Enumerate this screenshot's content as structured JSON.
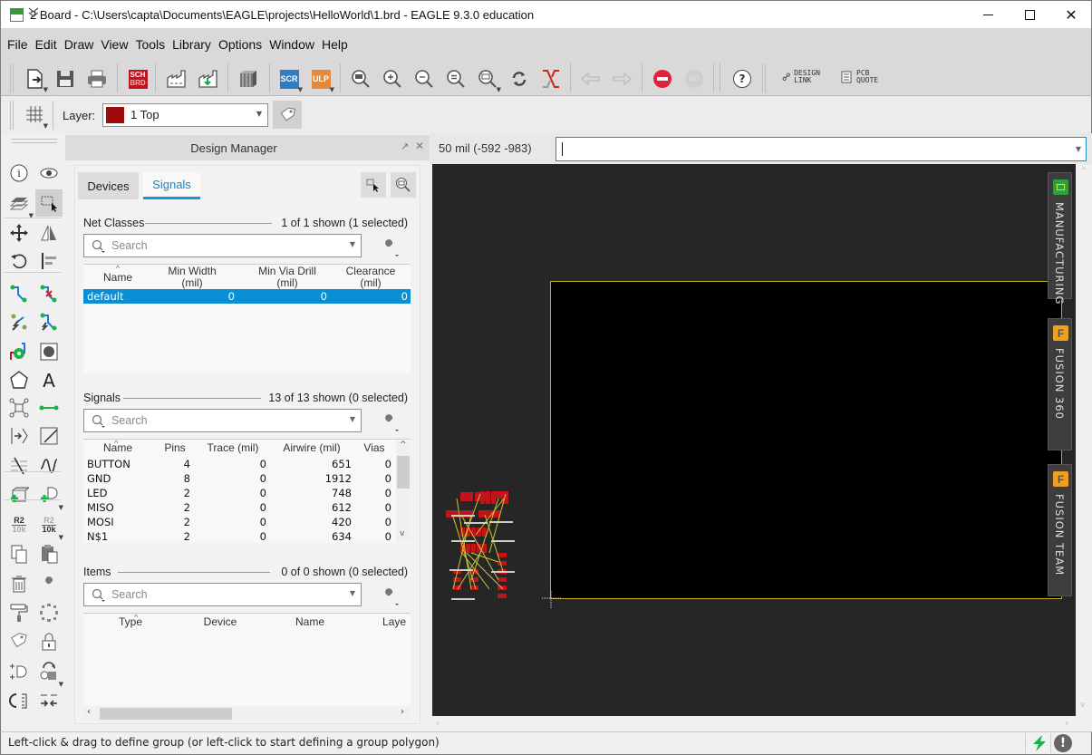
{
  "window": {
    "title": "2 Board - C:\\Users\\capta\\Documents\\EAGLE\\projects\\HelloWorld\\1.brd - EAGLE 9.3.0 education",
    "app_icon": "brd-file-icon",
    "controls": {
      "minimize": "—",
      "maximize": "☐",
      "close": "✕"
    }
  },
  "menu": [
    "File",
    "Edit",
    "Draw",
    "View",
    "Tools",
    "Library",
    "Options",
    "Window",
    "Help"
  ],
  "toolbar": {
    "items": [
      {
        "name": "open",
        "icon": "open-file-icon"
      },
      {
        "name": "save",
        "icon": "save-icon"
      },
      {
        "name": "print",
        "icon": "print-icon"
      },
      {
        "name": "switch-sch-brd",
        "icon": "sch-brd-icon",
        "label_top": "SCH",
        "label_bottom": "BRD"
      },
      {
        "name": "cam-processor",
        "icon": "factory-icon"
      },
      {
        "name": "manufacturing-export",
        "icon": "factory-download-icon"
      },
      {
        "name": "library-manager",
        "icon": "library-books-icon"
      },
      {
        "name": "script",
        "icon": "scr-icon",
        "label": "SCR",
        "color": "#2f7dc4"
      },
      {
        "name": "ulp",
        "icon": "ulp-icon",
        "label": "ULP",
        "color": "#e8893a"
      },
      {
        "name": "zoom-fit",
        "icon": "zoom-fit-icon"
      },
      {
        "name": "zoom-in",
        "icon": "zoom-in-icon"
      },
      {
        "name": "zoom-out",
        "icon": "zoom-out-icon"
      },
      {
        "name": "zoom-redraw",
        "icon": "zoom-equal-icon"
      },
      {
        "name": "zoom-select",
        "icon": "zoom-select-icon"
      },
      {
        "name": "redraw",
        "icon": "refresh-icon"
      },
      {
        "name": "ratsnest",
        "icon": "ratsnest-icon"
      },
      {
        "name": "undo",
        "icon": "undo-icon"
      },
      {
        "name": "redo",
        "icon": "redo-icon"
      },
      {
        "name": "stop",
        "icon": "stop-icon"
      },
      {
        "name": "go",
        "icon": "go-icon",
        "label": "GO"
      },
      {
        "name": "help",
        "icon": "help-icon",
        "label": "?"
      }
    ],
    "design_link": {
      "line1": "DESIGN",
      "line2": "LINK"
    },
    "pcb_quote": {
      "line1": "PCB",
      "line2": "QUOTE"
    }
  },
  "layerbar": {
    "label": "Layer:",
    "selected_layer": "1 Top",
    "layer_color": "#a00a0a"
  },
  "left_tools": [
    "info-icon",
    "eye-icon",
    "layers-icon",
    "group-select-icon",
    "move-icon",
    "mirror-icon",
    "rotate-icon",
    "align-icon",
    "route-icon",
    "ripup-icon",
    "autoroute-icon",
    "route-power-icon",
    "via-icon",
    "hole-icon",
    "polygon-icon",
    "text-icon",
    "ratsnest-node-icon",
    "wire-icon",
    "pin-swap-icon",
    "line-icon",
    "meander-icon",
    "sine-wave-icon",
    "add-package-icon",
    "add-part-icon",
    "name-icon",
    "value-icon",
    "copy-icon",
    "paste-icon",
    "delete-icon",
    "wrench-icon",
    "paint-roller-icon",
    "circle-dots-icon",
    "tag-icon",
    "lock-icon",
    "gate-swap-icon",
    "replace-icon",
    "cycle-icon",
    "split-icon",
    "more-chevron-icon"
  ],
  "left_tool_labels": {
    "name_top": "R2",
    "name_bottom": "10k",
    "value_top": "R2",
    "value_bottom": "10k"
  },
  "design_manager": {
    "title": "Design Manager",
    "tabs": [
      {
        "label": "Devices",
        "active": false
      },
      {
        "label": "Signals",
        "active": true
      }
    ],
    "net_classes": {
      "title": "Net Classes",
      "count": "1 of 1 shown (1 selected)",
      "search_placeholder": "Search",
      "columns": [
        "Name",
        "Min Width\n(mil)",
        "Min Via Drill\n(mil)",
        "Clearance\n(mil)"
      ],
      "rows": [
        {
          "name": "default",
          "min_width": "0",
          "min_via_drill": "0",
          "clearance": "0",
          "selected": true
        }
      ]
    },
    "signals": {
      "title": "Signals",
      "count": "13 of 13 shown (0 selected)",
      "search_placeholder": "Search",
      "columns": [
        "Name",
        "Pins",
        "Trace (mil)",
        "Airwire (mil)",
        "Vias"
      ],
      "rows": [
        {
          "name": "BUTTON",
          "pins": "4",
          "trace": "0",
          "airwire": "651",
          "vias": "0"
        },
        {
          "name": "GND",
          "pins": "8",
          "trace": "0",
          "airwire": "1912",
          "vias": "0"
        },
        {
          "name": "LED",
          "pins": "2",
          "trace": "0",
          "airwire": "748",
          "vias": "0"
        },
        {
          "name": "MISO",
          "pins": "2",
          "trace": "0",
          "airwire": "612",
          "vias": "0"
        },
        {
          "name": "MOSI",
          "pins": "2",
          "trace": "0",
          "airwire": "420",
          "vias": "0"
        },
        {
          "name": "N$1",
          "pins": "2",
          "trace": "0",
          "airwire": "634",
          "vias": "0"
        }
      ]
    },
    "items": {
      "title": "Items",
      "count": "0 of 0 shown (0 selected)",
      "search_placeholder": "Search",
      "columns": [
        "Type",
        "Device",
        "Name",
        "Laye"
      ]
    }
  },
  "canvas": {
    "grid_coord": "50 mil (-592 -983)",
    "command_value": "",
    "side_tabs": [
      {
        "label": "MANUFACTURING",
        "icon": "chip-icon",
        "color": "#2e9e3e"
      },
      {
        "label": "FUSION 360",
        "icon": "fusion-icon",
        "color": "#f0a020"
      },
      {
        "label": "FUSION TEAM",
        "icon": "fusion-icon",
        "color": "#f0a020"
      }
    ],
    "board_outline_color": "#c8a820",
    "pad_color": "#c0141c",
    "airwire_color": "#c8c832"
  },
  "status": {
    "message": "Left-click & drag to define group (or left-click to start defining a group polygon)",
    "icons": [
      "lightning-icon",
      "warning-icon"
    ]
  }
}
